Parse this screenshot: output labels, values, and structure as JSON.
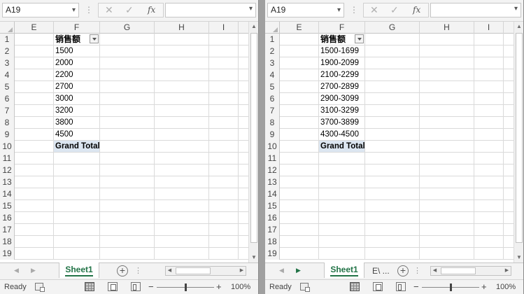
{
  "windows": [
    {
      "name_box": "A19",
      "formula_value": "",
      "columns": [
        "E",
        "F",
        "G",
        "H",
        "I"
      ],
      "rows": [
        "1",
        "2",
        "3",
        "4",
        "5",
        "6",
        "7",
        "8",
        "9",
        "10",
        "11",
        "12",
        "13",
        "14",
        "15",
        "16",
        "17",
        "18",
        "19"
      ],
      "pivot_header": "销售额",
      "values": [
        "1500",
        "2000",
        "2200",
        "2700",
        "3000",
        "3200",
        "3800",
        "4500"
      ],
      "grand_total": "Grand Total",
      "tabs": [
        "Sheet1"
      ],
      "status": "Ready",
      "zoom": "100%"
    },
    {
      "name_box": "A19",
      "formula_value": "",
      "columns": [
        "E",
        "F",
        "G",
        "H",
        "I"
      ],
      "rows": [
        "1",
        "2",
        "3",
        "4",
        "5",
        "6",
        "7",
        "8",
        "9",
        "10",
        "11",
        "12",
        "13",
        "14",
        "15",
        "16",
        "17",
        "18",
        "19"
      ],
      "pivot_header": "销售额",
      "values": [
        "1500-1699",
        "1900-2099",
        "2100-2299",
        "2700-2899",
        "2900-3099",
        "3100-3299",
        "3700-3899",
        "4300-4500"
      ],
      "grand_total": "Grand Total",
      "tabs": [
        "Sheet1",
        "E\\ ..."
      ],
      "status": "Ready",
      "zoom": "100%"
    }
  ],
  "icons": {
    "cancel": "✕",
    "enter": "✓",
    "function": "fx",
    "add_sheet": "+",
    "zoom_out": "−",
    "zoom_in": "+"
  },
  "zoom_level": 1.0,
  "colors": {
    "accent": "#217346",
    "total_fill": "#dce6f1"
  }
}
